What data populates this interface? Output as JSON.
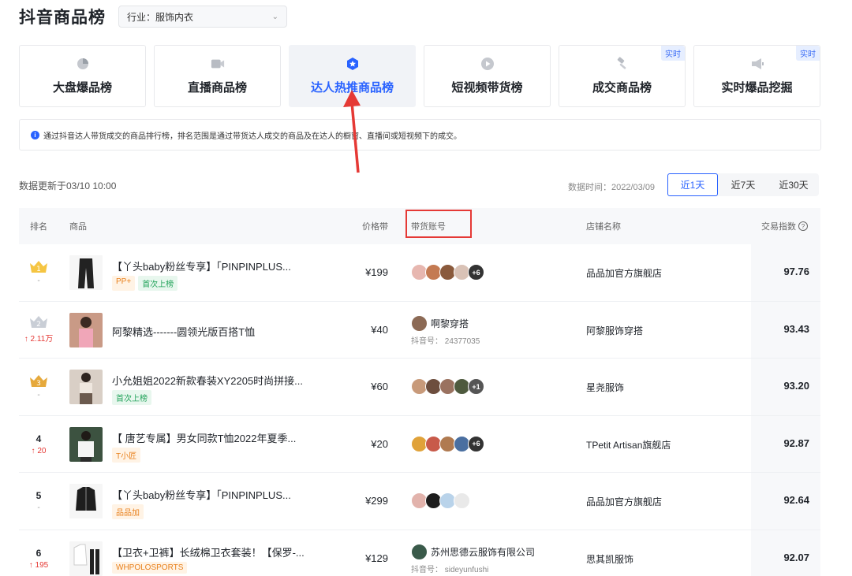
{
  "header": {
    "title": "抖音商品榜",
    "industry_select": "行业：服饰内衣"
  },
  "cards": [
    {
      "label": "大盘爆品榜",
      "icon": "pie-chart-icon",
      "tag": ""
    },
    {
      "label": "直播商品榜",
      "icon": "video-camera-icon",
      "tag": ""
    },
    {
      "label": "达人热推商品榜",
      "icon": "star-badge-icon",
      "tag": "",
      "active": true
    },
    {
      "label": "短视频带货榜",
      "icon": "play-circle-icon",
      "tag": ""
    },
    {
      "label": "成交商品榜",
      "icon": "gavel-icon",
      "tag": "实时"
    },
    {
      "label": "实时爆品挖掘",
      "icon": "megaphone-icon",
      "tag": "实时"
    }
  ],
  "notice": "通过抖音达人带货成交的商品排行榜，排名范围是通过带货达人成交的商品及在达人的橱窗、直播间或短视频下的成交。",
  "update_text": "数据更新于03/10 10:00",
  "data_time": "数据时间：2022/03/09",
  "ranges": [
    "近1天",
    "近7天",
    "近30天"
  ],
  "colors": {
    "accent": "#2962ff",
    "highlight": "#e53935"
  },
  "table": {
    "headers": {
      "rank": "排名",
      "product": "商品",
      "price": "价格带",
      "account": "带货账号",
      "shop": "店铺名称",
      "index": "交易指数"
    },
    "rows": [
      {
        "rank": "1",
        "change": "-",
        "name": "【丫头baby粉丝专享】「PINPINPLUS...",
        "badges": [
          "PP+",
          "首次上榜"
        ],
        "price": "¥199",
        "accounts_more": "+6",
        "shop": "品品加官方旗舰店",
        "score": "97.76"
      },
      {
        "rank": "2",
        "change": "2.11万",
        "name": "阿黎精选-------圆领光版百搭T恤",
        "badges": [],
        "price": "¥40",
        "account_name": "啊黎穿搭",
        "account_id": "抖音号： 24377035",
        "shop": "阿黎服饰穿搭",
        "score": "93.43"
      },
      {
        "rank": "3",
        "change": "-",
        "name": "小允姐姐2022新款春装XY2205时尚拼接...",
        "badges": [
          "首次上榜"
        ],
        "price": "¥60",
        "accounts_more": "+1",
        "shop": "星尧服饰",
        "score": "93.20"
      },
      {
        "rank": "4",
        "change": "20",
        "name": "【 唐艺专属】男女同款T恤2022年夏季...",
        "badges": [
          "T小匠"
        ],
        "price": "¥20",
        "accounts_more": "+6",
        "shop": "TPetit Artisan旗舰店",
        "score": "92.87"
      },
      {
        "rank": "5",
        "change": "-",
        "name": "【丫头baby粉丝专享】「PINPINPLUS...",
        "badges": [
          "品品加"
        ],
        "price": "¥299",
        "accounts_more": "",
        "shop": "品品加官方旗舰店",
        "score": "92.64"
      },
      {
        "rank": "6",
        "change": "195",
        "name": "【卫衣+卫裤】长绒棉卫衣套装！【保罗-...",
        "badges": [
          "WHPOLOSPORTS"
        ],
        "price": "¥129",
        "account_name": "苏州思德云服饰有限公司",
        "account_id": "抖音号： sideyunfushi",
        "shop": "思其凯服饰",
        "score": "92.07"
      }
    ]
  }
}
